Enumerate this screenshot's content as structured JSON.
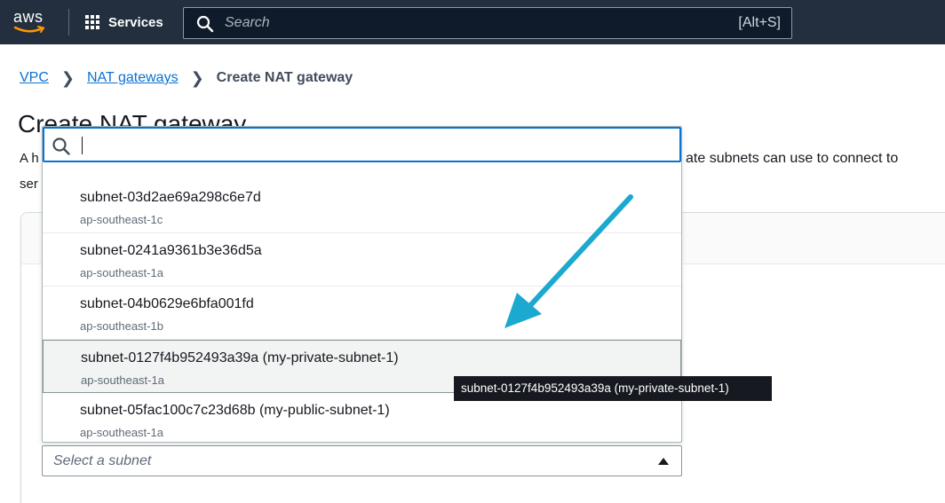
{
  "topnav": {
    "logo_text": "aws",
    "services_label": "Services",
    "search_placeholder": "Search",
    "search_shortcut": "[Alt+S]"
  },
  "breadcrumb": {
    "items": [
      "VPC",
      "NAT gateways"
    ],
    "current": "Create NAT gateway"
  },
  "page": {
    "title": "Create NAT gateway",
    "desc_left_1": "A h",
    "desc_left_2": "ser",
    "desc_right": "ate subnets can use to connect to"
  },
  "dropdown": {
    "search_value": "",
    "options": [
      {
        "title": "subnet-03d2ae69a298c6e7d",
        "sub": "ap-southeast-1c"
      },
      {
        "title": "subnet-0241a9361b3e36d5a",
        "sub": "ap-southeast-1a"
      },
      {
        "title": "subnet-04b0629e6bfa001fd",
        "sub": "ap-southeast-1b"
      },
      {
        "title": "subnet-0127f4b952493a39a (my-private-subnet-1)",
        "sub": "ap-southeast-1a"
      },
      {
        "title": "subnet-05fac100c7c23d68b (my-public-subnet-1)",
        "sub": "ap-southeast-1a"
      }
    ],
    "highlighted_index": 3
  },
  "select": {
    "placeholder": "Select a subnet"
  },
  "tooltip": {
    "text": "subnet-0127f4b952493a39a (my-private-subnet-1)"
  },
  "colors": {
    "nav_bg": "#232f3e",
    "link": "#0972d3",
    "focus": "#0972d3",
    "arrow": "#1ba9d0",
    "aws_smile": "#ff9900"
  }
}
